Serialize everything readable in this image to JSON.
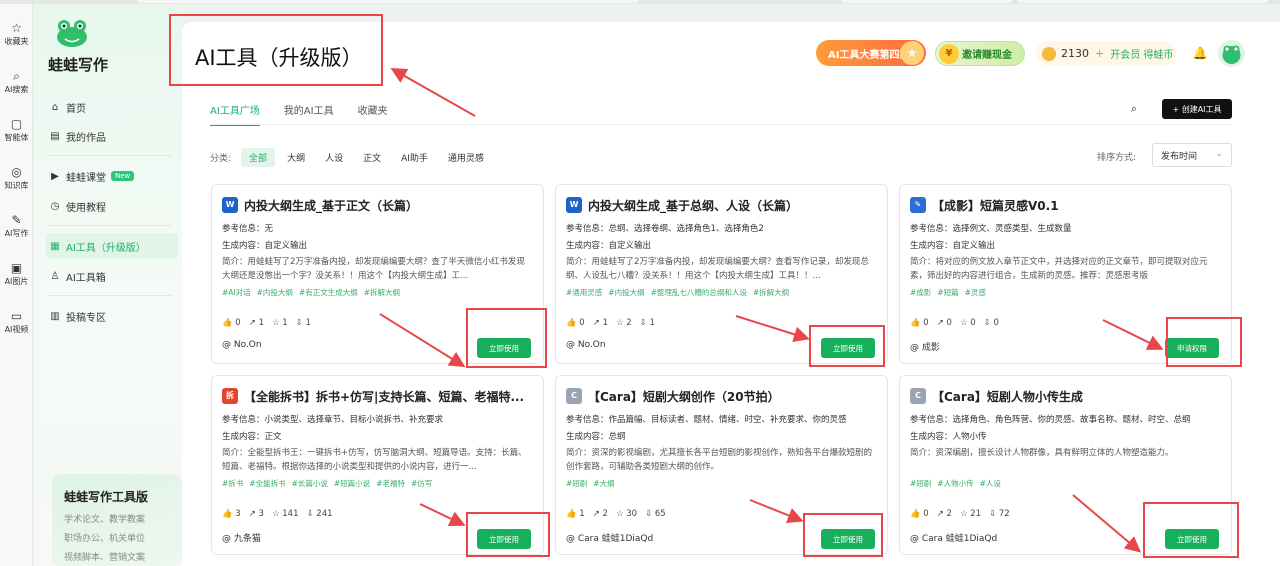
{
  "rail": [
    {
      "icon": "star-icon",
      "glyph": "☆",
      "label": "收藏夹"
    },
    {
      "icon": "search-icon",
      "glyph": "⌕",
      "label": "AI搜索"
    },
    {
      "icon": "robot-icon",
      "glyph": "▢",
      "label": "智能体"
    },
    {
      "icon": "knowledge-icon",
      "glyph": "◎",
      "label": "知识库"
    },
    {
      "icon": "pen-icon",
      "glyph": "✎",
      "label": "AI写作"
    },
    {
      "icon": "image-icon",
      "glyph": "▣",
      "label": "AI图片"
    },
    {
      "icon": "video-icon",
      "glyph": "▭",
      "label": "AI视频"
    }
  ],
  "app": {
    "name": "蛙蛙写作"
  },
  "nav": [
    {
      "icon": "home-icon",
      "glyph": "⌂",
      "label": "首页"
    },
    {
      "icon": "works-icon",
      "glyph": "▤",
      "label": "我的作品"
    },
    {
      "icon": "course-icon",
      "glyph": "▶",
      "label": "蛙蛙课堂",
      "badge": "New"
    },
    {
      "icon": "tutorial-icon",
      "glyph": "◷",
      "label": "使用教程"
    },
    {
      "icon": "ai-tool-icon",
      "glyph": "▦",
      "label": "AI工具（升级版）"
    },
    {
      "icon": "toolbox-icon",
      "glyph": "♙",
      "label": "AI工具箱"
    },
    {
      "icon": "submit-icon",
      "glyph": "▥",
      "label": "投稿专区"
    }
  ],
  "promo": {
    "title": "蛙蛙写作工具版",
    "lines": [
      "学术论文、教学教案",
      "职场办公、机关单位",
      "视频脚本、营销文案"
    ]
  },
  "page": {
    "title": "AI工具（升级版）"
  },
  "header": {
    "contest": "AI工具大赛第四期",
    "invite": "邀请赚现金",
    "coins": "2130",
    "plus": "+",
    "vip": "开会员 得蛙币"
  },
  "tabs": [
    "AI工具广场",
    "我的AI工具",
    "收藏夹"
  ],
  "toolbar": {
    "create": "+ 创建AI工具"
  },
  "filter": {
    "label": "分类:",
    "chips": [
      "全部",
      "大纲",
      "人设",
      "正文",
      "AI助手",
      "通用灵感"
    ]
  },
  "sort": {
    "label": "排序方式:",
    "value": "发布时间"
  },
  "colors": {
    "accent": "#1bb069",
    "annotation": "#e8474a"
  },
  "cards": [
    {
      "icon_text": "W",
      "icon_color": "#1e63c8",
      "title": "内投大纲生成_基于正文（长篇）",
      "ref": "参考信息：无",
      "gen": "生成内容：自定义输出",
      "desc": "简介：用蛙蛙写了2万字准备内投，却发现编编要大纲？查了半天微信小红书发现大纲还是没憋出一个字？没关系！！用这个【内投大纲生成】工...",
      "tags": [
        "#AI对话",
        "#内投大纲",
        "#有正文生成大纲",
        "#拆解大纲"
      ],
      "stats": [
        "👍 0",
        "↗ 1",
        "☆ 1",
        "⇩ 1"
      ],
      "author": "@ No.On",
      "button": "立即使用"
    },
    {
      "icon_text": "W",
      "icon_color": "#1e63c8",
      "title": "内投大纲生成_基于总纲、人设（长篇）",
      "ref": "参考信息：总纲、选择卷纲、选择角色1、选择角色2",
      "gen": "生成内容：自定义输出",
      "desc": "简介：用蛙蛙写了2万字准备内投，却发现编编要大纲？查看写作记录，却发现总纲、人设乱七八糟？没关系！！用这个【内投大纲生成】工具！！...",
      "tags": [
        "#通用灵感",
        "#内投大纲",
        "#整理乱七八糟的总纲和人设",
        "#拆解大纲"
      ],
      "stats": [
        "👍 0",
        "↗ 1",
        "☆ 2",
        "⇩ 1"
      ],
      "author": "@ No.On",
      "button": "立即使用"
    },
    {
      "icon_text": "✎",
      "icon_color": "#2b6fd6",
      "title": "【成影】短篇灵感V0.1",
      "ref": "参考信息：选择例文、灵感类型、生成数量",
      "gen": "生成内容：自定义输出",
      "desc": "简介：将对应的例文放入章节正文中，并选择对应的正文章节，即可提取对应元素，筛出好的内容进行组合，生成新的灵感。推荐：灵感思考版",
      "tags": [
        "#成影",
        "#短篇",
        "#灵感"
      ],
      "stats": [
        "👍 0",
        "↗ 0",
        "☆ 0",
        "⇩ 0"
      ],
      "author": "@ 成影",
      "button": "申请权限"
    },
    {
      "icon_text": "拆",
      "icon_color": "#e0452f",
      "title": "【全能拆书】拆书+仿写|支持长篇、短篇、老福特...",
      "ref": "参考信息：小说类型、选择章节、目标小说拆书、补充要求",
      "gen": "生成内容：正文",
      "desc": "简介：全能型拆书王：一键拆书+仿写，仿写脑洞大纲、短篇导语。支持：长篇、短篇、老福特。根据你选择的小说类型和提供的小说内容，进行一...",
      "tags": [
        "#拆书",
        "#全能拆书",
        "#长篇小说",
        "#短篇小说",
        "#老福特",
        "#仿写"
      ],
      "stats": [
        "👍 3",
        "↗ 3",
        "☆ 141",
        "⇩ 241"
      ],
      "author": "@ 九条猫",
      "button": "立即使用"
    },
    {
      "icon_text": "C",
      "icon_color": "#9aa3b3",
      "title": "【Cara】短剧大纲创作（20节拍）",
      "ref": "参考信息：作品篇幅、目标读者、题材、情绪、时空、补充要求、你的灵感",
      "gen": "生成内容：总纲",
      "desc": "简介：资深的影视编剧，尤其擅长各平台短剧的影视创作，熟知各平台爆款短剧的创作套路，可辅助各类短剧大纲的创作。",
      "tags": [
        "#短剧",
        "#大纲"
      ],
      "stats": [
        "👍 1",
        "↗ 2",
        "☆ 30",
        "⇩ 65"
      ],
      "author": "@ Cara 蛙蛙1DiaQd",
      "button": "立即使用"
    },
    {
      "icon_text": "C",
      "icon_color": "#9aa3b3",
      "title": "【Cara】短剧人物小传生成",
      "ref": "参考信息：选择角色、角色阵营、你的灵感、故事名称、题材、时空、总纲",
      "gen": "生成内容：人物小传",
      "desc": "简介：资深编剧，擅长设计人物群像，具有鲜明立体的人物塑造能力。",
      "tags": [
        "#短剧",
        "#人物小传",
        "#人设"
      ],
      "stats": [
        "👍 0",
        "↗ 2",
        "☆ 21",
        "⇩ 72"
      ],
      "author": "@ Cara 蛙蛙1DiaQd",
      "button": "立即使用"
    }
  ]
}
